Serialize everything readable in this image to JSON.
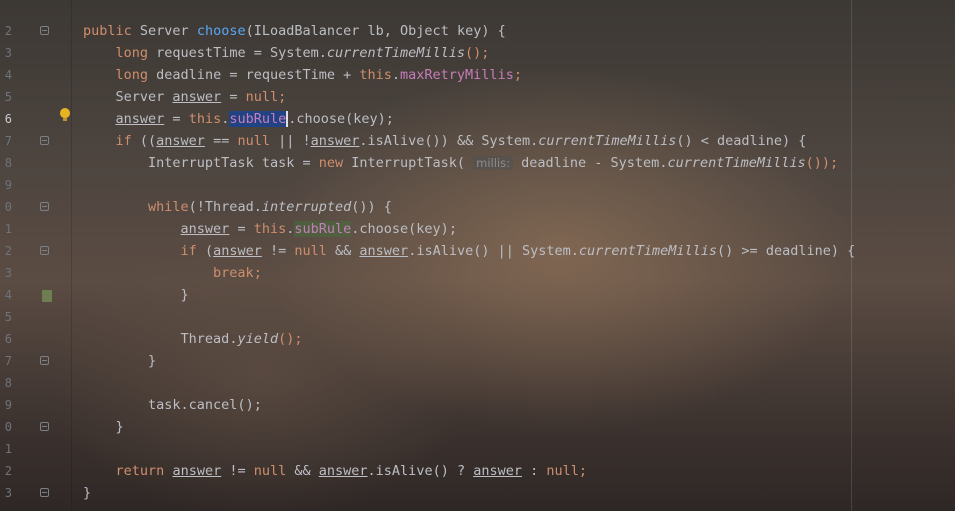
{
  "editor": {
    "line_numbers": [
      "2",
      "3",
      "4",
      "5",
      "6",
      "7",
      "8",
      "9",
      "0",
      "1",
      "2",
      "3",
      "4",
      "5",
      "6",
      "7",
      "8",
      "9",
      "0",
      "1",
      "2",
      "3"
    ],
    "current_line": "6",
    "hint_label": "millis:",
    "tokens": {
      "public": "public",
      "server_type": "Server",
      "choose": "choose",
      "params": "(ILoadBalancer lb, Object key) {",
      "long": "long",
      "request_time_decl": "requestTime = System.",
      "current_time_millis": "currentTimeMillis",
      "call_end": "();",
      "deadline_decl": "deadline = requestTime + ",
      "this": "this",
      "dot": ".",
      "max_retry_millis": "maxRetryMillis",
      "semicolon": ";",
      "server_sp": "Server ",
      "answer": "answer",
      "eq_sp": " = ",
      "null": "null",
      "sub_rule": "subRule",
      "choose_call": ".choose(key);",
      "if": "if",
      "if_open": " ((",
      "eq_eq": " == ",
      "or_not": " || !",
      "is_alive_and": ".isAlive()) && System.",
      "lt_deadline": "() < deadline) {",
      "interrupt_task_decl": "InterruptTask task = ",
      "new": "new",
      "interrupt_task_ctor": " InterruptTask( ",
      "deadline_minus": " deadline - System.",
      "paren_close": "());",
      "while": "while",
      "while_open": "(!Thread.",
      "interrupted": "interrupted",
      "while_close": "()) {",
      "if_sp_open": " (",
      "neq": " != ",
      "and_sp": " && ",
      "is_alive_or": ".isAlive() || System.",
      "gte_deadline": "() >= deadline) {",
      "break": "break",
      "close_brace": "}",
      "thread_dot": "Thread.",
      "yield": "yield",
      "task_cancel": "task.cancel();",
      "return": "return",
      "ternary_q": ".isAlive() ? ",
      "ternary_colon": " : "
    }
  }
}
